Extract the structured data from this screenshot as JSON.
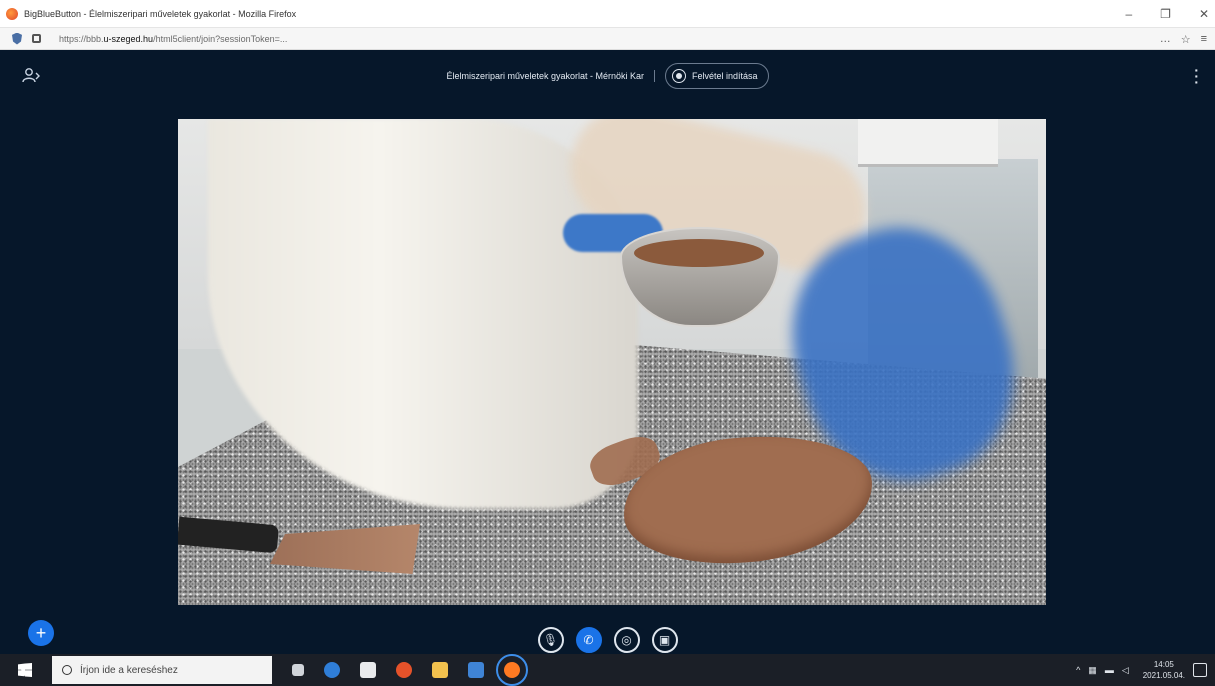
{
  "browser": {
    "window_title": "BigBlueButton - Élelmiszeripari műveletek gyakorlat - Mozilla Firefox",
    "url_prefix": "https://bbb.",
    "url_domain": "u-szeged.hu",
    "url_path": "/html5client/join?sessionToken=...",
    "window_controls": [
      "–",
      "❐",
      "✕"
    ],
    "toolbar_icons": [
      "…",
      "☆",
      "≡"
    ]
  },
  "meeting": {
    "title": "Élelmiszeripari műveletek gyakorlat - Mérnöki Kar",
    "record_label": "Felvétel indítása",
    "users_icon": "users-icon",
    "options_icon": "kebab-icon"
  },
  "controls": {
    "plus_label": "+",
    "mic_icon": "🎙",
    "phone_icon": "✆",
    "camera_icon": "◎",
    "screen_icon": "▣"
  },
  "taskbar": {
    "search_placeholder": "Írjon ide a kereséshez",
    "time": "14:05",
    "date": "2021.05.04.",
    "apps": [
      {
        "name": "task-view",
        "color": "#d0d4da"
      },
      {
        "name": "edge",
        "color": "#2f7ed8"
      },
      {
        "name": "store",
        "color": "#e8eaed"
      },
      {
        "name": "office",
        "color": "#e5522a"
      },
      {
        "name": "file-explorer",
        "color": "#f2c14e"
      },
      {
        "name": "outlook",
        "color": "#3f84d6"
      },
      {
        "name": "firefox",
        "color": "#ff7a22"
      }
    ]
  },
  "colors": {
    "app_bg": "#06172a",
    "accent": "#1a73e8",
    "taskbar_bg": "#1b1f27"
  }
}
